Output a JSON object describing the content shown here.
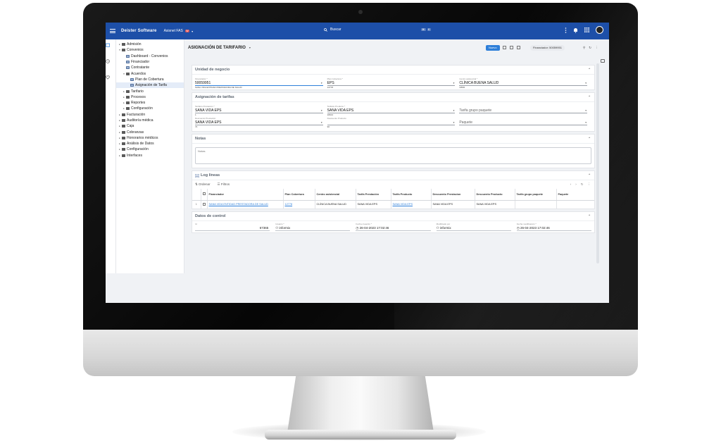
{
  "topbar": {
    "app_title": "Deister Software",
    "company": "Asisnet FAS",
    "company_badge": "W",
    "search_label": "Buscar",
    "search_keys": [
      "⌘",
      "K"
    ]
  },
  "tree": [
    {
      "label": "Admisión",
      "level": 0,
      "arrow": "▸",
      "icon": "folder"
    },
    {
      "label": "Convenios",
      "level": 0,
      "arrow": "▾",
      "icon": "folder"
    },
    {
      "label": "Dashboard - Convenios",
      "level": 1,
      "arrow": "",
      "icon": "doc"
    },
    {
      "label": "Financiador",
      "level": 1,
      "arrow": "",
      "icon": "doc"
    },
    {
      "label": "Contratante",
      "level": 1,
      "arrow": "",
      "icon": "doc"
    },
    {
      "label": "Acuerdos",
      "level": 1,
      "arrow": "▾",
      "icon": "folder"
    },
    {
      "label": "Plan de Cobertura",
      "level": 2,
      "arrow": "",
      "icon": "doc"
    },
    {
      "label": "Asignación de Tarifa",
      "level": 2,
      "arrow": "",
      "icon": "doc",
      "selected": true
    },
    {
      "label": "Tarifario",
      "level": 1,
      "arrow": "▸",
      "icon": "folder"
    },
    {
      "label": "Procesos",
      "level": 1,
      "arrow": "▸",
      "icon": "folder"
    },
    {
      "label": "Reportes",
      "level": 1,
      "arrow": "▸",
      "icon": "folder"
    },
    {
      "label": "Configuración",
      "level": 1,
      "arrow": "▸",
      "icon": "folder"
    },
    {
      "label": "Facturación",
      "level": 0,
      "arrow": "▸",
      "icon": "folder"
    },
    {
      "label": "Auditoría médica",
      "level": 0,
      "arrow": "▸",
      "icon": "folder"
    },
    {
      "label": "Caja",
      "level": 0,
      "arrow": "▸",
      "icon": "folder"
    },
    {
      "label": "Cobranzas",
      "level": 0,
      "arrow": "▸",
      "icon": "folder"
    },
    {
      "label": "Honorarios médicos",
      "level": 0,
      "arrow": "▸",
      "icon": "folder"
    },
    {
      "label": "Análisis de Datos",
      "level": 0,
      "arrow": "▸",
      "icon": "folder"
    },
    {
      "label": "Configuración",
      "level": 0,
      "arrow": "▸",
      "icon": "folder"
    },
    {
      "label": "Interfaces",
      "level": 0,
      "arrow": "▸",
      "icon": "folder"
    }
  ],
  "page": {
    "title": "ASIGNACIÓN DE TARIFARIO",
    "new_label": "Nuevo",
    "financiador_chip": "Financiador: 50059951"
  },
  "unidad": {
    "title": "Unidad de negocio",
    "fields": [
      {
        "label": "Financiador *",
        "value": "50059951",
        "sub": "SANA VIDA ENTIDAD PRESTADORA DE SALUD"
      },
      {
        "label": "Plan Cobertura *",
        "value": "EPS",
        "sub": "12778"
      },
      {
        "label": "Centro asistencial *",
        "value": "CLÍNICA BUENA SALUD",
        "sub": "CBS5"
      }
    ]
  },
  "asignacion": {
    "title": "Asignación de tarifas",
    "row1": [
      {
        "label": "Tarifario Prestación *",
        "value": "SANA VIDA EPS",
        "sub": "1"
      },
      {
        "label": "Tarifario Producto *",
        "value": "SANA VIDA EPS",
        "sub": "18013"
      },
      {
        "label": "",
        "value": "Tarifa grupo paquete",
        "sub": ""
      }
    ],
    "row2": [
      {
        "label": "Descuento Prestación",
        "value": "SANA VIDA EPS",
        "sub": "74"
      },
      {
        "label": "Descuento Producto",
        "value": "",
        "sub": "90"
      },
      {
        "label": "",
        "value": "Paquete",
        "sub": ""
      }
    ]
  },
  "notas": {
    "title": "Notas",
    "placeholder": "Notas"
  },
  "log": {
    "title": "Log líneas",
    "ordenar": "Ordenar",
    "filtros": "Filtros",
    "columns": [
      "Financiador",
      "Plan Cobertura",
      "Centro asistencial",
      "Tarifa Prestación",
      "Tarifa Producto",
      "Descuento Prestacion",
      "Descuento Producto",
      "Tarifa grupo paquete",
      "Paquete"
    ],
    "rows": [
      {
        "num": "1",
        "financiador": "SANA VIDA ENTIDAD PRESTADORA DE SALUD",
        "plan": "12778",
        "centro": "CLÍNICA BUENA SALUD",
        "tarifa_prest": "SANA VIDA EPS",
        "tarifa_prod": "SANA VIDA EPS",
        "desc_prest": "SANA VIDA EPS",
        "desc_prod": "SANA VIDA EPS",
        "grupo": "",
        "paquete": ""
      }
    ]
  },
  "control": {
    "title": "Datos de control",
    "fields": [
      {
        "label": "Id",
        "value": "67365",
        "sub": ""
      },
      {
        "label": "Usuario *",
        "value": "informix",
        "sub": ""
      },
      {
        "label": "Fecha creación *",
        "value": "26-04-2023 17:02:46",
        "sub": ""
      },
      {
        "label": "Modificado por",
        "value": "informix",
        "sub": ""
      },
      {
        "label": "Fecha modificación *",
        "value": "26-04-2023 17:02:46",
        "sub": ""
      }
    ]
  },
  "colors": {
    "topbar": "#1d4fa8",
    "accent": "#2e7fd9"
  }
}
